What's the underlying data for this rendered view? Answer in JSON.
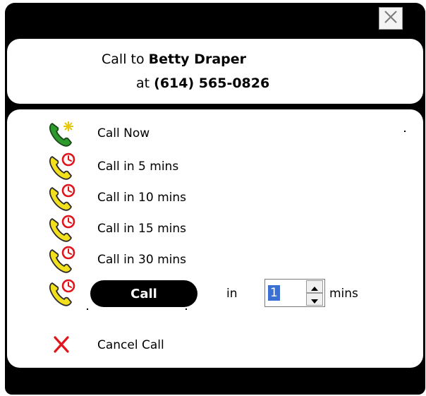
{
  "dialog": {
    "call_to_prefix": "Call to",
    "contact_name": "Betty Draper",
    "at_prefix": "at",
    "phone_number": "(614) 565-0826"
  },
  "menu": {
    "call_now": "Call Now",
    "call_5": "Call in 5 mins",
    "call_10": "Call in 10 mins",
    "call_15": "Call in 15 mins",
    "call_30": "Call in 30 mins",
    "call_button": "Call",
    "in_label": "in",
    "minutes_value": "1",
    "mins_label": "mins",
    "cancel_call": "Cancel Call"
  },
  "icons": {
    "close": "close-icon",
    "call_now": "phone-star-icon",
    "scheduled": "phone-clock-icon",
    "cancel": "cancel-x-icon"
  },
  "colors": {
    "phone_green": "#2e9a2e",
    "phone_yellow": "#f2df1e",
    "clock_red": "#e0141c",
    "cancel_red": "#e0141c",
    "selection_blue": "#3b6fd1"
  }
}
